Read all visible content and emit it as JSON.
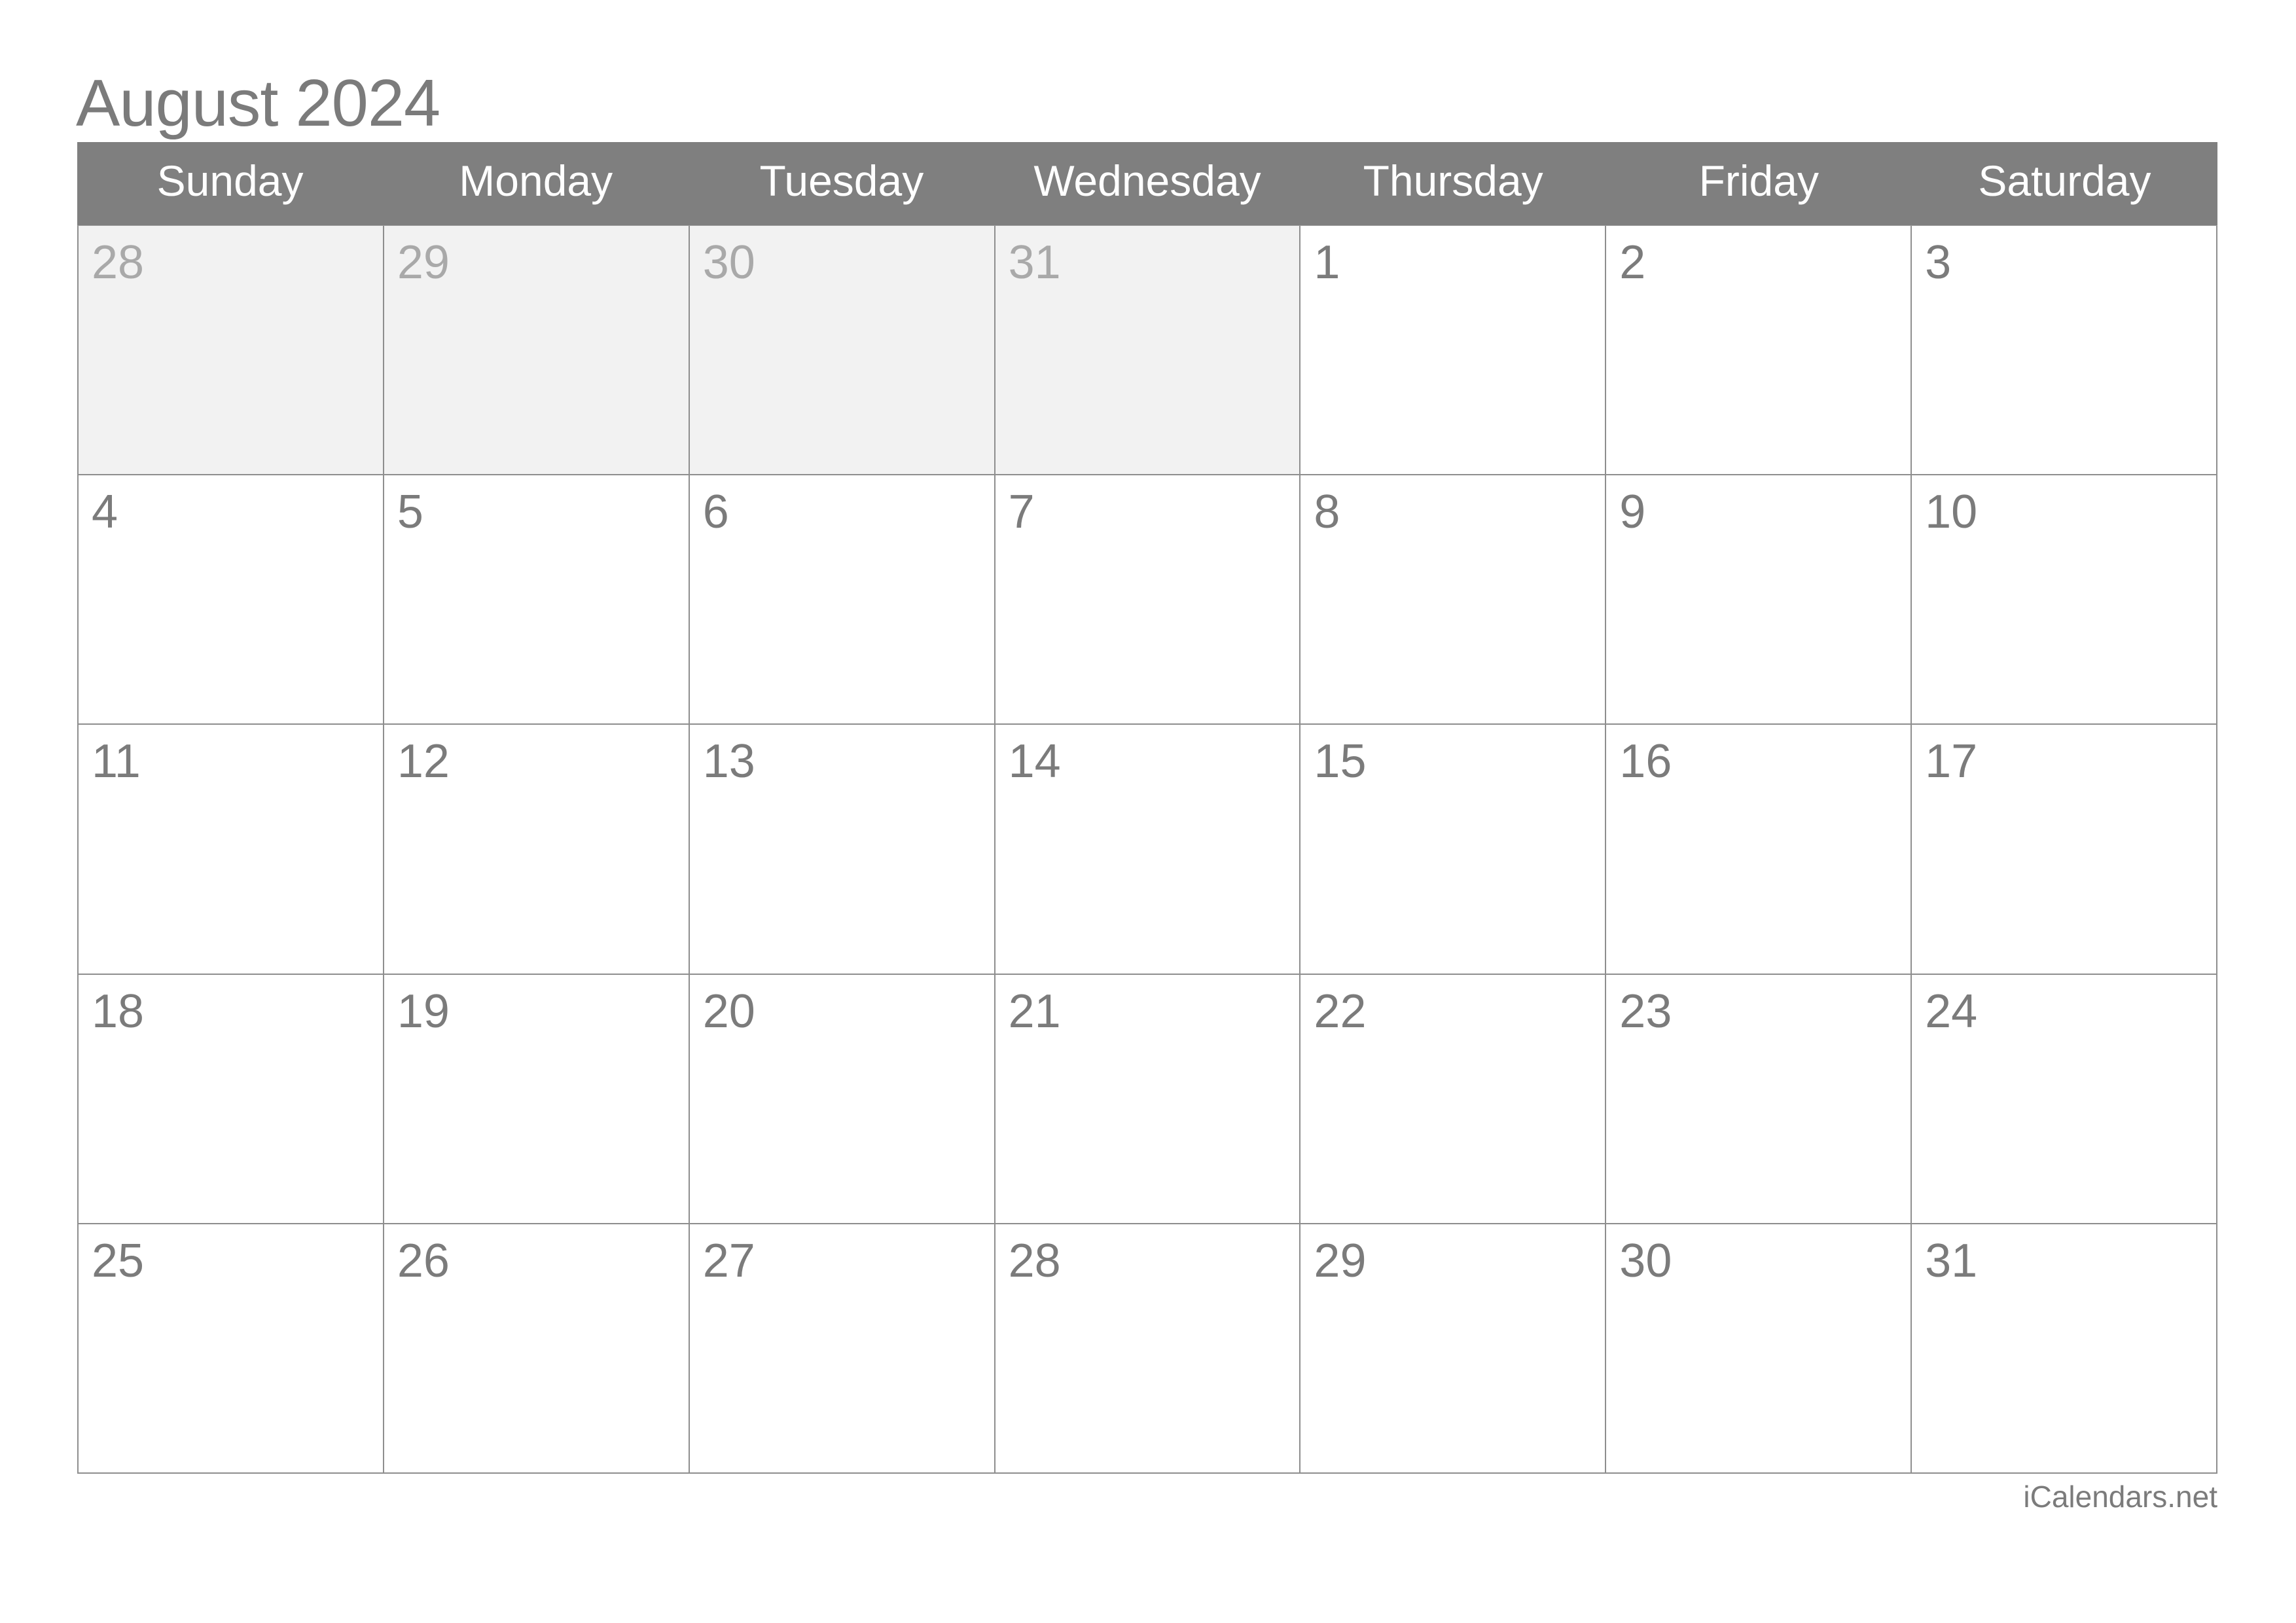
{
  "title": "August 2024",
  "weekdays": [
    "Sunday",
    "Monday",
    "Tuesday",
    "Wednesday",
    "Thursday",
    "Friday",
    "Saturday"
  ],
  "weeks": [
    [
      {
        "day": "28",
        "other": true
      },
      {
        "day": "29",
        "other": true
      },
      {
        "day": "30",
        "other": true
      },
      {
        "day": "31",
        "other": true
      },
      {
        "day": "1",
        "other": false
      },
      {
        "day": "2",
        "other": false
      },
      {
        "day": "3",
        "other": false
      }
    ],
    [
      {
        "day": "4",
        "other": false
      },
      {
        "day": "5",
        "other": false
      },
      {
        "day": "6",
        "other": false
      },
      {
        "day": "7",
        "other": false
      },
      {
        "day": "8",
        "other": false
      },
      {
        "day": "9",
        "other": false
      },
      {
        "day": "10",
        "other": false
      }
    ],
    [
      {
        "day": "11",
        "other": false
      },
      {
        "day": "12",
        "other": false
      },
      {
        "day": "13",
        "other": false
      },
      {
        "day": "14",
        "other": false
      },
      {
        "day": "15",
        "other": false
      },
      {
        "day": "16",
        "other": false
      },
      {
        "day": "17",
        "other": false
      }
    ],
    [
      {
        "day": "18",
        "other": false
      },
      {
        "day": "19",
        "other": false
      },
      {
        "day": "20",
        "other": false
      },
      {
        "day": "21",
        "other": false
      },
      {
        "day": "22",
        "other": false
      },
      {
        "day": "23",
        "other": false
      },
      {
        "day": "24",
        "other": false
      }
    ],
    [
      {
        "day": "25",
        "other": false
      },
      {
        "day": "26",
        "other": false
      },
      {
        "day": "27",
        "other": false
      },
      {
        "day": "28",
        "other": false
      },
      {
        "day": "29",
        "other": false
      },
      {
        "day": "30",
        "other": false
      },
      {
        "day": "31",
        "other": false
      }
    ]
  ],
  "footer": "iCalendars.net",
  "colors": {
    "header_bg": "#7f7f7f",
    "header_text": "#ffffff",
    "text": "#7b7b7b",
    "other_month_text": "#a9a9a9",
    "other_month_bg": "#f2f2f2",
    "grid_line": "#8e8e8e"
  }
}
